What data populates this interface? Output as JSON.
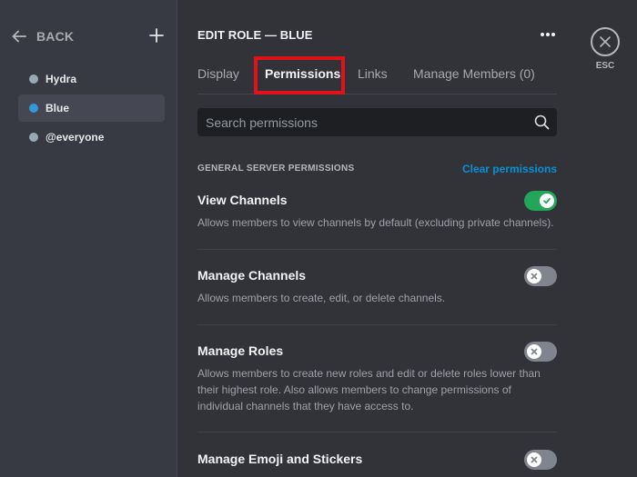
{
  "sidebar": {
    "back_label": "BACK",
    "roles": [
      {
        "name": "Hydra",
        "color": "#99aab5",
        "selected": false
      },
      {
        "name": "Blue",
        "color": "#3498db",
        "selected": true
      },
      {
        "name": "@everyone",
        "color": "#99aab5",
        "selected": false
      }
    ]
  },
  "header": {
    "title": "EDIT ROLE — BLUE"
  },
  "tabs": [
    {
      "label": "Display",
      "active": false
    },
    {
      "label": "Permissions",
      "active": true
    },
    {
      "label": "Links",
      "active": false
    },
    {
      "label": "Manage Members (0)",
      "active": false
    }
  ],
  "search": {
    "placeholder": "Search permissions",
    "value": ""
  },
  "section": {
    "title": "GENERAL SERVER PERMISSIONS",
    "clear_label": "Clear permissions"
  },
  "permissions": [
    {
      "name": "View Channels",
      "description": "Allows members to view channels by default (excluding private channels).",
      "enabled": true
    },
    {
      "name": "Manage Channels",
      "description": "Allows members to create, edit, or delete channels.",
      "enabled": false
    },
    {
      "name": "Manage Roles",
      "description": "Allows members to create new roles and edit or delete roles lower than their highest role. Also allows members to change permissions of individual channels that they have access to.",
      "enabled": false
    },
    {
      "name": "Manage Emoji and Stickers",
      "description": "",
      "enabled": false
    }
  ],
  "close": {
    "label": "ESC"
  },
  "colors": {
    "toggle_on": "#23a55a",
    "toggle_off": "#80848e",
    "link": "#00a8fc",
    "annotation_highlight": "#e0121a"
  }
}
